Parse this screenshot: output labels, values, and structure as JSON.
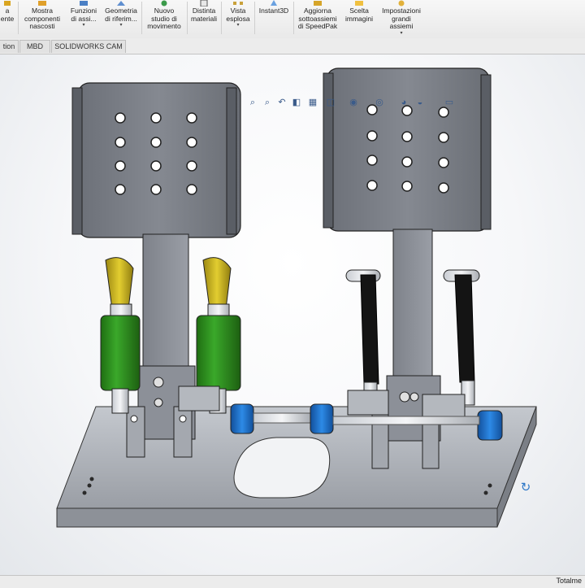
{
  "ribbon": {
    "items": [
      {
        "label": "a\nente",
        "icon": "component-icon"
      },
      {
        "label": "Mostra\ncomponenti\nnascosti",
        "icon": "show-hidden-icon"
      },
      {
        "label": "Funzioni\ndi assi...",
        "icon": "assembly-features-icon",
        "dropdown": "▾"
      },
      {
        "label": "Geometria\ndi riferim...",
        "icon": "reference-geometry-icon",
        "dropdown": "▾"
      },
      {
        "label": "Nuovo\nstudio di\nmovimento",
        "icon": "motion-study-icon"
      },
      {
        "label": "Distinta\nmateriali",
        "icon": "bom-icon"
      },
      {
        "label": "Vista\nesplosa",
        "icon": "exploded-view-icon",
        "dropdown": "▾"
      },
      {
        "label": "Instant3D",
        "icon": "instant3d-icon"
      },
      {
        "label": "Aggiorna\nsottoassiemi\ndi SpeedPak",
        "icon": "speedpak-icon"
      },
      {
        "label": "Scelta\nimmagini",
        "icon": "snapshot-icon"
      },
      {
        "label": "Impostazioni\ngrandi\nassiemi",
        "icon": "large-assembly-icon",
        "dropdown": "▾"
      }
    ]
  },
  "tabs": [
    "tion",
    "MBD",
    "SOLIDWORKS CAM"
  ],
  "hud_icons": [
    "zoom-to-fit-icon",
    "zoom-area-icon",
    "previous-view-icon",
    "section-view-icon",
    "dynamic-annotation-icon",
    "view-orientation-icon",
    "display-style-icon",
    "hide-show-icon",
    "edit-appearance-icon",
    "apply-scene-icon",
    "view-settings-icon"
  ],
  "status": {
    "text": "Totalme"
  },
  "colors": {
    "part_gray": "#7b7f86",
    "plate": "#a9adb3",
    "spring_green": "#2e8b1e",
    "rod_end_yellow": "#c9b41a",
    "spacer_blue": "#1e6fc7",
    "rod_black": "#1a1a1a"
  }
}
